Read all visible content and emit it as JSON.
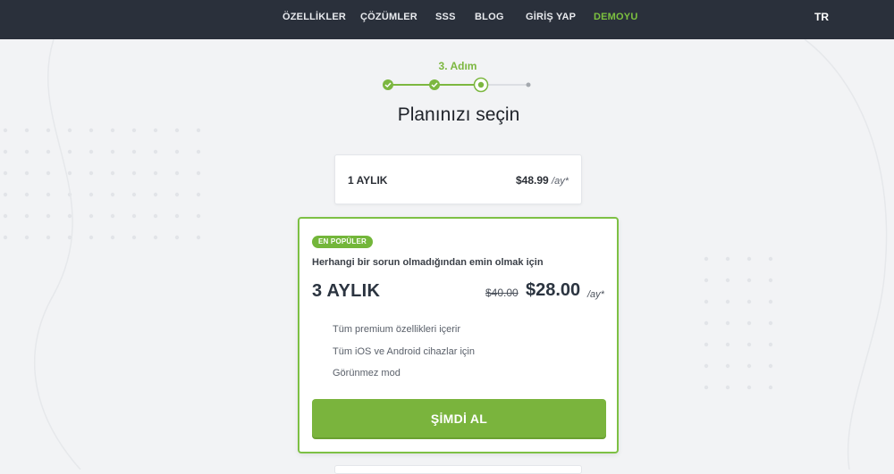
{
  "nav": {
    "items": [
      {
        "label": "ÖZELLİKLER"
      },
      {
        "label": "ÇÖZÜMLER"
      },
      {
        "label": "SSS"
      },
      {
        "label": "BLOG"
      },
      {
        "label": "GİRİŞ YAP"
      },
      {
        "label": "DEMOYU"
      }
    ],
    "lang": "TR",
    "accent_color": "#7cc13f"
  },
  "stepper": {
    "label": "3. Adım",
    "total_steps": 4,
    "completed_steps": 2,
    "current_step": 3
  },
  "page": {
    "title": "Planınızı seçin"
  },
  "plans": {
    "monthly": {
      "name": "1 AYLIK",
      "price": "$48.99",
      "per": "/ay*"
    },
    "featured": {
      "badge": "EN POPÜLER",
      "subtitle": "Herhangi bir sorun olmadığından emin olmak için",
      "name": "3 AYLIK",
      "old_price": "$40.00",
      "price": "$28.00",
      "per": "/ay*",
      "features": [
        "Tüm premium özellikleri içerir",
        "Tüm iOS ve Android cihazlar için",
        "Görünmez mod"
      ],
      "cta": "ŞİMDİ AL",
      "border_color": "#7dc044",
      "button_color": "#7ab43d"
    }
  }
}
